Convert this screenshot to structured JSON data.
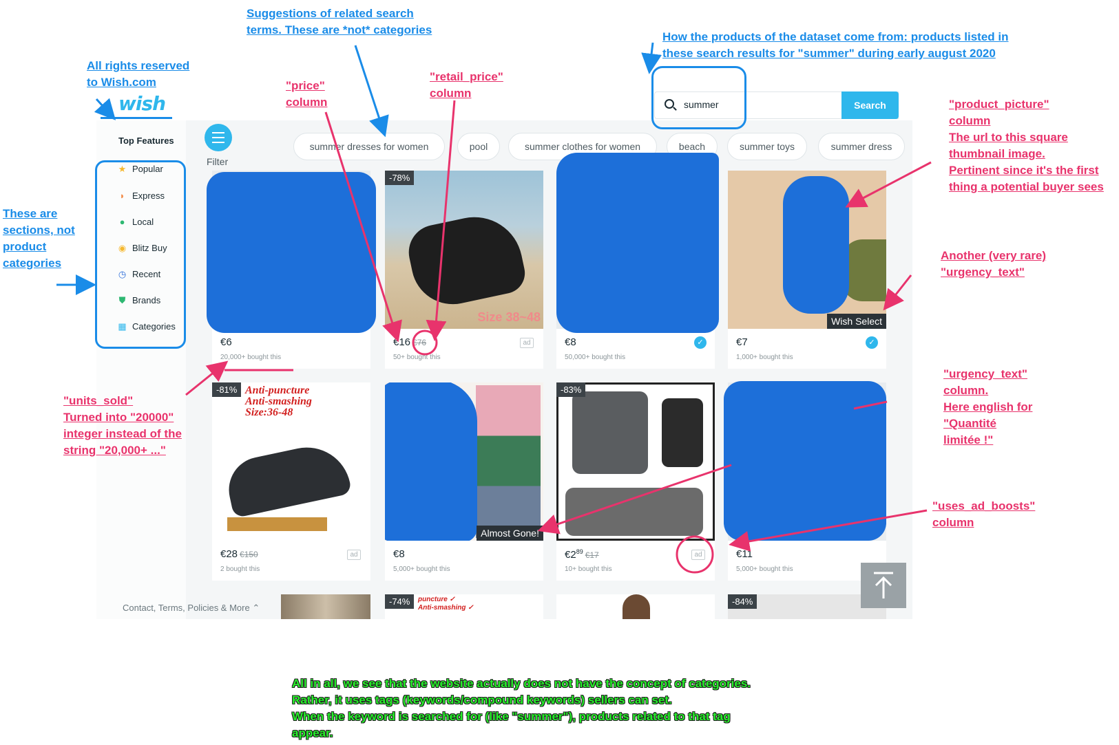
{
  "header": {
    "logo": "wish"
  },
  "search": {
    "value": "summer",
    "button": "Search"
  },
  "sidebar": {
    "title": "Top Features",
    "items": [
      {
        "label": "Popular",
        "icon": "star-icon"
      },
      {
        "label": "Express",
        "icon": "express-icon"
      },
      {
        "label": "Local",
        "icon": "location-pin-icon"
      },
      {
        "label": "Blitz Buy",
        "icon": "blitz-buy-icon"
      },
      {
        "label": "Recent",
        "icon": "clock-icon"
      },
      {
        "label": "Brands",
        "icon": "shield-check-icon"
      },
      {
        "label": "Categories",
        "icon": "grid-icon"
      }
    ]
  },
  "filter": {
    "label": "Filter"
  },
  "chips": [
    "summer dresses for women",
    "pool",
    "summer clothes for women",
    "beach",
    "summer toys",
    "summer dress"
  ],
  "products": [
    {
      "price": "€6",
      "sold": "20,000+ bought this"
    },
    {
      "price": "€16",
      "old_price": "€76",
      "sold": "50+ bought this",
      "discount": "-78%",
      "ad": "ad",
      "overlay": "Size 38~48"
    },
    {
      "price": "€8",
      "sold": "50,000+ bought this"
    },
    {
      "price": "€7",
      "sold": "1,000+ bought this",
      "urgency": "Wish Select"
    },
    {
      "price": "€28",
      "old_price": "€150",
      "sold": "2 bought this",
      "discount": "-81%",
      "ad": "ad",
      "overlay": "Anti-puncture\nAnti-smashing\nSize:36-48"
    },
    {
      "price": "€8",
      "sold": "5,000+ bought this",
      "urgency": "Almost Gone!"
    },
    {
      "price": "€2",
      "price_sup": "89",
      "old_price": "€17",
      "sold": "10+ bought this",
      "discount": "-83%",
      "ad": "ad"
    },
    {
      "price": "€11",
      "sold": "5,000+ bought this"
    }
  ],
  "bottom_row": [
    {
      "discount": ""
    },
    {
      "discount": "-74%",
      "overlay": "puncture ✓\nAnti-smashing ✓"
    },
    {
      "discount": ""
    },
    {
      "discount": "-84%"
    }
  ],
  "footer": {
    "link": "Contact, Terms, Policies & More ⌃"
  },
  "annotations": {
    "rights": "All rights reserved\nto Wish.com",
    "suggestions": "Suggestions of related search\nterms. These are *not* categories",
    "dataset": "How the products of the dataset come from: products listed in\nthese search results for \"summer\" during early august 2020",
    "price": "\"price\"\ncolumn",
    "retail_price": "\"retail_price\"\ncolumn",
    "product_picture": "\"product_picture\"\ncolumn\nThe url to this square\nthumbnail image.\nPertinent since it's the first\nthing a potential buyer sees",
    "sections": "These are\nsections, not\nproduct\ncategories",
    "rare_urgency": "Another (very rare)\n\"urgency_text\"",
    "units_sold": "\"units_sold\"\nTurned into \"20000\"\ninteger instead of the\nstring \"20,000+ ...\"",
    "urgency_text": "\"urgency_text\"\ncolumn.\nHere english for\n\"Quantité\nlimitée !\"",
    "ad_boosts": "\"uses_ad_boosts\"\ncolumn",
    "conclusion": "All in all, we see that the website actually does not have the concept of categories.\nRather, it uses tags (keywords/compound keywords) sellers can set.\nWhen the keyword is searched for (like \"summer\"), products related to that tag\nappear."
  },
  "colors": {
    "brand": "#2fb7ec",
    "annotation_blue": "#1a8ce8",
    "annotation_pink": "#e8336c",
    "annotation_green": "#26f02a",
    "redaction": "#1d6fd9"
  }
}
